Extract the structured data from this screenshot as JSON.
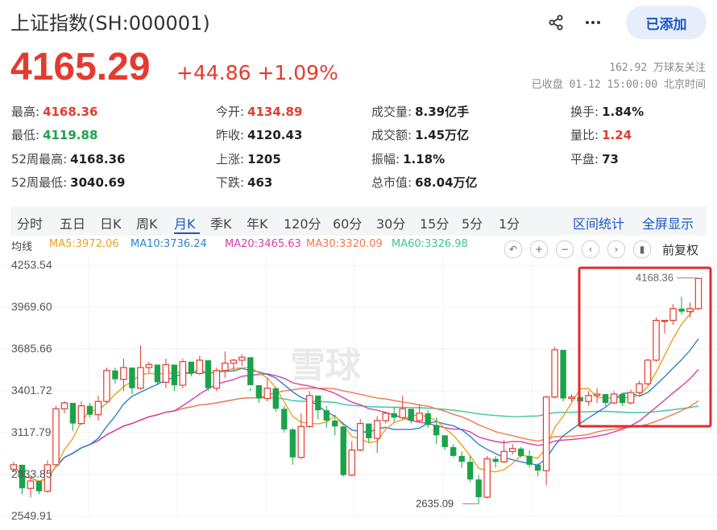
{
  "header": {
    "title": "上证指数(SH:000001)",
    "add_label": "已添加"
  },
  "quote": {
    "price": "4165.29",
    "change": "+44.86 +1.09%",
    "followers": "162.92 万球友关注",
    "status": "已收盘 01-12 15:00:00 北京时间"
  },
  "stats": [
    {
      "k": "最高:",
      "v": "4168.36",
      "c": "red"
    },
    {
      "k": "今开:",
      "v": "4134.89",
      "c": "red"
    },
    {
      "k": "成交量:",
      "v": "8.39亿手",
      "c": ""
    },
    {
      "k": "换手:",
      "v": "1.84%",
      "c": ""
    },
    {
      "k": "最低:",
      "v": "4119.88",
      "c": "green"
    },
    {
      "k": "昨收:",
      "v": "4120.43",
      "c": ""
    },
    {
      "k": "成交额:",
      "v": "1.45万亿",
      "c": ""
    },
    {
      "k": "量比:",
      "v": "1.24",
      "c": "red"
    },
    {
      "k": "52周最高:",
      "v": "4168.36",
      "c": ""
    },
    {
      "k": "上涨:",
      "v": "1205",
      "c": ""
    },
    {
      "k": "振幅:",
      "v": "1.18%",
      "c": ""
    },
    {
      "k": "平盘:",
      "v": "73",
      "c": ""
    },
    {
      "k": "52周最低:",
      "v": "3040.69",
      "c": ""
    },
    {
      "k": "下跌:",
      "v": "463",
      "c": ""
    },
    {
      "k": "总市值:",
      "v": "68.04万亿",
      "c": ""
    }
  ],
  "tabs": [
    "分时",
    "五日",
    "日K",
    "周K",
    "月K",
    "季K",
    "年K",
    "120分",
    "60分",
    "30分",
    "15分",
    "5分",
    "1分"
  ],
  "active_tab": "月K",
  "links": {
    "range": "区间统计",
    "fullscreen": "全屏显示"
  },
  "ma": {
    "label": "均线",
    "items": [
      {
        "text": "MA5:3972.06",
        "color": "#f0a020"
      },
      {
        "text": "MA10:3736.24",
        "color": "#2f80d0"
      },
      {
        "text": "MA20:3465.63",
        "color": "#d63fa6"
      },
      {
        "text": "MA30:3320.09",
        "color": "#f07a50"
      },
      {
        "text": "MA60:3326.98",
        "color": "#3ec49a"
      }
    ]
  },
  "controls": {
    "fq": "前复权",
    "icons": [
      "undo-icon",
      "plus-icon",
      "minus-icon",
      "chevron-left-icon",
      "chevron-right-icon",
      "candle-icon"
    ]
  },
  "chart": {
    "y_labels": [
      "4253.54",
      "3969.60",
      "3685.66",
      "3401.72",
      "3117.79",
      "2833.85",
      "2549.91"
    ],
    "max_label": "4168.36",
    "min_label": "2635.09",
    "watermark": "雪球",
    "colors": {
      "up": "#e33b2f",
      "down": "#1aa34a",
      "highlight": "#e32b2b"
    }
  },
  "chart_data": {
    "type": "candlestick",
    "ylim": [
      2549.91,
      4253.54
    ],
    "ohlc": [
      [
        2870,
        2920,
        2850,
        2900
      ],
      [
        2900,
        2880,
        2700,
        2740
      ],
      [
        2740,
        2820,
        2680,
        2790
      ],
      [
        2790,
        2780,
        2700,
        2720
      ],
      [
        2720,
        2930,
        2710,
        2900
      ],
      [
        2900,
        3300,
        2890,
        3280
      ],
      [
        3280,
        3330,
        3250,
        3320
      ],
      [
        3320,
        3200,
        3130,
        3180
      ],
      [
        3180,
        3330,
        3170,
        3300
      ],
      [
        3300,
        3320,
        3220,
        3240
      ],
      [
        3240,
        3370,
        3200,
        3330
      ],
      [
        3330,
        3560,
        3320,
        3540
      ],
      [
        3540,
        3560,
        3450,
        3480
      ],
      [
        3480,
        3620,
        3400,
        3560
      ],
      [
        3560,
        3470,
        3380,
        3420
      ],
      [
        3420,
        3710,
        3410,
        3560
      ],
      [
        3560,
        3600,
        3520,
        3580
      ],
      [
        3580,
        3540,
        3440,
        3460
      ],
      [
        3460,
        3620,
        3420,
        3580
      ],
      [
        3580,
        3480,
        3400,
        3440
      ],
      [
        3440,
        3620,
        3420,
        3600
      ],
      [
        3600,
        3560,
        3500,
        3520
      ],
      [
        3520,
        3640,
        3510,
        3610
      ],
      [
        3610,
        3580,
        3400,
        3420
      ],
      [
        3420,
        3560,
        3400,
        3540
      ],
      [
        3540,
        3670,
        3490,
        3590
      ],
      [
        3590,
        3620,
        3540,
        3610
      ],
      [
        3610,
        3650,
        3570,
        3630
      ],
      [
        3630,
        3420,
        3400,
        3440
      ],
      [
        3440,
        3380,
        3320,
        3350
      ],
      [
        3350,
        3490,
        3330,
        3420
      ],
      [
        3420,
        3350,
        3260,
        3280
      ],
      [
        3280,
        3300,
        3120,
        3140
      ],
      [
        3140,
        3150,
        2900,
        2950
      ],
      [
        2950,
        3250,
        2940,
        3160
      ],
      [
        3160,
        3400,
        3150,
        3370
      ],
      [
        3370,
        3360,
        3210,
        3270
      ],
      [
        3270,
        3300,
        3150,
        3200
      ],
      [
        3200,
        3240,
        3100,
        3160
      ],
      [
        3160,
        3080,
        2820,
        2830
      ],
      [
        2830,
        3060,
        2820,
        3000
      ],
      [
        3000,
        3210,
        2990,
        3180
      ],
      [
        3180,
        3120,
        3050,
        3080
      ],
      [
        3080,
        3230,
        2980,
        3200
      ],
      [
        3200,
        3260,
        3180,
        3250
      ],
      [
        3250,
        3290,
        3190,
        3220
      ],
      [
        3220,
        3370,
        3210,
        3280
      ],
      [
        3280,
        3250,
        3180,
        3200
      ],
      [
        3200,
        3310,
        3190,
        3250
      ],
      [
        3250,
        3270,
        3150,
        3170
      ],
      [
        3170,
        3220,
        3040,
        3100
      ],
      [
        3100,
        3080,
        3000,
        3020
      ],
      [
        3020,
        3040,
        2950,
        2960
      ],
      [
        2960,
        2990,
        2880,
        2920
      ],
      [
        2920,
        2960,
        2780,
        2800
      ],
      [
        2800,
        2830,
        2635,
        2680
      ],
      [
        2680,
        2960,
        2670,
        2940
      ],
      [
        2940,
        2960,
        2880,
        2920
      ],
      [
        2920,
        3070,
        2910,
        2990
      ],
      [
        2990,
        3040,
        2970,
        3010
      ],
      [
        3010,
        3020,
        2950,
        2960
      ],
      [
        2960,
        3000,
        2880,
        2900
      ],
      [
        2900,
        2910,
        2820,
        2860
      ],
      [
        2860,
        3370,
        2760,
        3360
      ],
      [
        3360,
        3700,
        3350,
        3680
      ],
      [
        3680,
        3370,
        3330,
        3350
      ],
      [
        3350,
        3380,
        3330,
        3360
      ],
      [
        3360,
        3380,
        3310,
        3330
      ],
      [
        3330,
        3400,
        3300,
        3370
      ],
      [
        3370,
        3420,
        3320,
        3380
      ],
      [
        3380,
        3360,
        3300,
        3320
      ],
      [
        3320,
        3400,
        3310,
        3380
      ],
      [
        3380,
        3370,
        3300,
        3320
      ],
      [
        3320,
        3410,
        3310,
        3390
      ],
      [
        3390,
        3470,
        3380,
        3450
      ],
      [
        3450,
        3620,
        3440,
        3610
      ],
      [
        3610,
        3900,
        3600,
        3880
      ],
      [
        3880,
        3880,
        3790,
        3880
      ],
      [
        3880,
        3990,
        3850,
        3960
      ],
      [
        3960,
        4040,
        3920,
        3940
      ],
      [
        3940,
        4000,
        3900,
        3960
      ],
      [
        3960,
        4168,
        3950,
        4165
      ]
    ],
    "ma_series": {
      "MA5": "3972.06",
      "MA10": "3736.24",
      "MA20": "3465.63",
      "MA30": "3320.09",
      "MA60": "3326.98"
    }
  }
}
